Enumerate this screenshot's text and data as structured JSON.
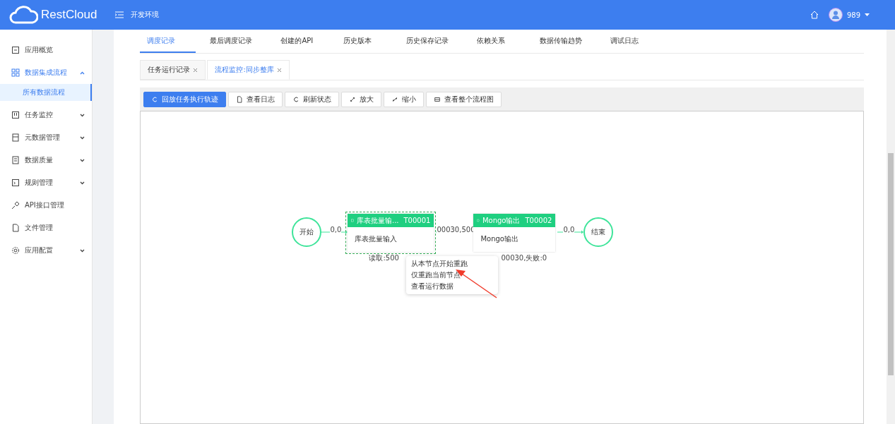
{
  "header": {
    "logo": "RestCloud",
    "environment": "开发环境",
    "user": "989"
  },
  "sidebar": {
    "items": [
      {
        "label": "应用概览",
        "selected": false
      },
      {
        "label": "数据集成流程",
        "selected": false,
        "expanded": true,
        "children": [
          {
            "label": "所有数据流程",
            "selected": true
          }
        ]
      },
      {
        "label": "任务监控",
        "selected": false,
        "expanded": false
      },
      {
        "label": "元数据管理",
        "selected": false,
        "expanded": false
      },
      {
        "label": "数据质量",
        "selected": false,
        "expanded": false
      },
      {
        "label": "规则管理",
        "selected": false,
        "expanded": false
      },
      {
        "label": "API接口管理",
        "selected": false
      },
      {
        "label": "文件管理",
        "selected": false
      },
      {
        "label": "应用配置",
        "selected": false,
        "expanded": false
      }
    ]
  },
  "tabs": [
    {
      "label": "调度记录",
      "selected": true
    },
    {
      "label": "最后调度记录",
      "selected": false
    },
    {
      "label": "创建的API",
      "selected": false
    },
    {
      "label": "历史版本",
      "selected": false
    },
    {
      "label": "历史保存记录",
      "selected": false
    },
    {
      "label": "依赖关系",
      "selected": false
    },
    {
      "label": "数据传输趋势",
      "selected": false
    },
    {
      "label": "调试日志",
      "selected": false
    }
  ],
  "subtabs": [
    {
      "label": "任务运行记录",
      "selected": false
    },
    {
      "label": "流程监控:同步整库",
      "selected": true
    }
  ],
  "toolbar": [
    {
      "label": "回放任务执行轨迹",
      "kind": "primary"
    },
    {
      "label": "查看日志",
      "kind": "default"
    },
    {
      "label": "刷新状态",
      "kind": "default"
    },
    {
      "label": "放大",
      "kind": "default"
    },
    {
      "label": "缩小",
      "kind": "default"
    },
    {
      "label": "查看整个流程图",
      "kind": "default"
    }
  ],
  "diagram": {
    "start": "开始",
    "end": "结束",
    "tasks": [
      {
        "title": "库表批量输...",
        "id": "T00001",
        "body": "库表批量输入",
        "selected": true
      },
      {
        "title": "Mongo输出",
        "id": "T00002",
        "body": "Mongo输出",
        "selected": false
      }
    ],
    "edge_labels": [
      "0,0",
      "00030,500",
      "0,0"
    ],
    "stats": [
      "读取:500",
      "00030,失败:0"
    ],
    "context_menu": [
      "从本节点开始重跑",
      "仅重跑当前节点",
      "查看运行数据"
    ]
  }
}
